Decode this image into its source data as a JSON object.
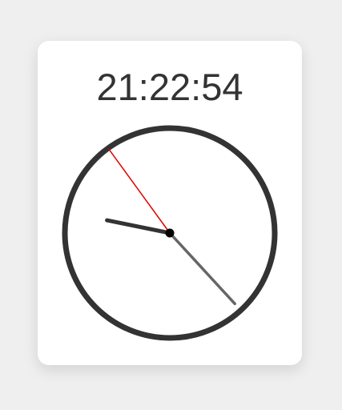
{
  "clock": {
    "digital_time": "21:22:54",
    "hours": 21,
    "minutes": 22,
    "seconds": 54
  },
  "colors": {
    "background": "#efefef",
    "card": "#ffffff",
    "face_rim": "#333333",
    "hour_hand": "#333333",
    "minute_hand": "#666666",
    "second_hand": "#e00000",
    "center": "#000000"
  }
}
